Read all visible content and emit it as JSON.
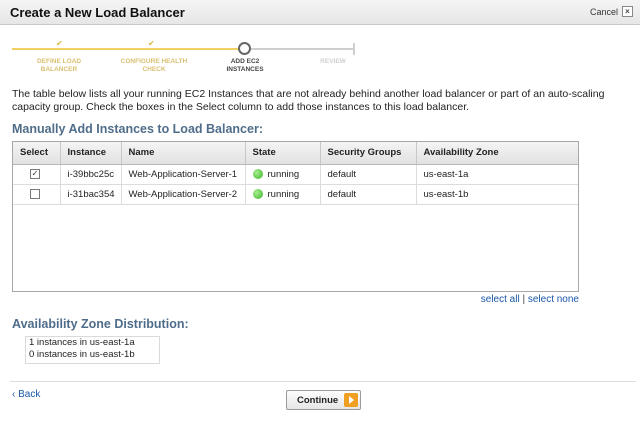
{
  "dialog": {
    "title": "Create a New Load Balancer",
    "cancel_label": "Cancel",
    "close_glyph": "×"
  },
  "wizard": {
    "steps": [
      {
        "label": "DEFINE LOAD BALANCER",
        "state": "complete"
      },
      {
        "label": "CONFIGURE HEALTH CHECK",
        "state": "complete"
      },
      {
        "label": "ADD EC2 INSTANCES",
        "state": "current"
      },
      {
        "label": "REVIEW",
        "state": "upcoming"
      }
    ],
    "check_glyph": "✔"
  },
  "intro_text": "The table below lists all your running EC2 Instances that are not already behind another load balancer or part of an auto-scaling capacity group. Check the boxes in the Select column to add those instances to this load balancer.",
  "manual_section_title": "Manually Add Instances to Load Balancer:",
  "table": {
    "columns": [
      "Select",
      "Instance",
      "Name",
      "State",
      "Security Groups",
      "Availability Zone"
    ],
    "rows": [
      {
        "selected": true,
        "instance": "i-39bbc25c",
        "name": "Web-Application-Server-1",
        "state": "running",
        "security_group": "default",
        "zone": "us-east-1a"
      },
      {
        "selected": false,
        "instance": "i-31bac354",
        "name": "Web-Application-Server-2",
        "state": "running",
        "security_group": "default",
        "zone": "us-east-1b"
      }
    ],
    "checked_glyph": "✓",
    "state_color": "#3cb52a"
  },
  "select_links": {
    "select_all": "select all",
    "separator": "|",
    "select_none": "select none"
  },
  "distribution": {
    "title": "Availability Zone Distribution:",
    "lines": [
      "1 instances in us-east-1a",
      "0 instances in us-east-1b"
    ]
  },
  "footer": {
    "back_label": "Back",
    "back_glyph": "‹",
    "continue_label": "Continue",
    "continue_icon": "arrow-right-icon"
  },
  "colors": {
    "accent_heading": "#4f6d8a",
    "link": "#1a56a8",
    "wizard_done": "#f0d060",
    "continue_arrow": "#f0a020"
  }
}
